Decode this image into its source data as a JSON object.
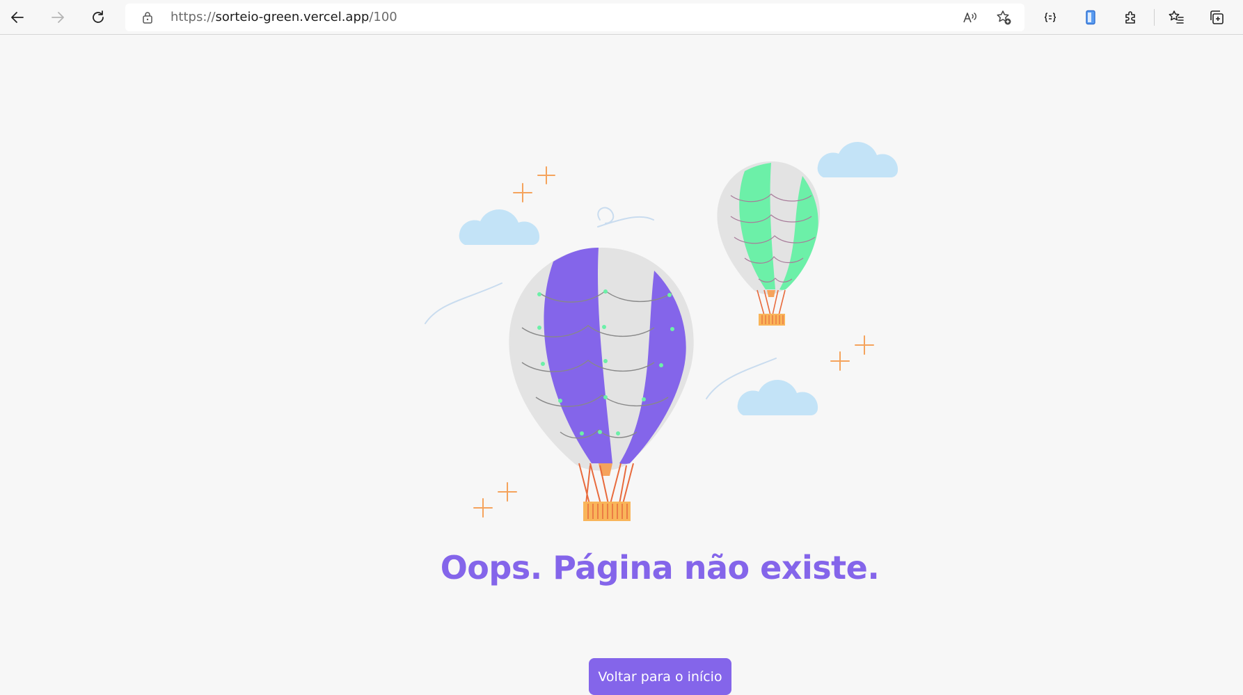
{
  "browser": {
    "url_scheme": "https://",
    "url_host": "sorteio-green.vercel.app",
    "url_path": "/100",
    "buttons": {
      "back": "back-arrow-icon",
      "forward": "forward-arrow-icon",
      "refresh": "refresh-icon",
      "read_aloud": "read-aloud-icon",
      "add_favorite": "add-favorite-icon",
      "dev_tools": "code-braces-icon",
      "phone": "phone-icon",
      "extensions": "puzzle-icon",
      "favorites": "favorites-icon",
      "collections": "collections-icon"
    }
  },
  "page": {
    "heading": "Oops. Página não existe.",
    "button_label": "Voltar para o início"
  },
  "colors": {
    "accent": "#8465ea",
    "secondary": "#6cf0a8",
    "background": "#f7f7f7",
    "cloud": "#c3e3f7",
    "sparkle": "#f5a35c"
  }
}
